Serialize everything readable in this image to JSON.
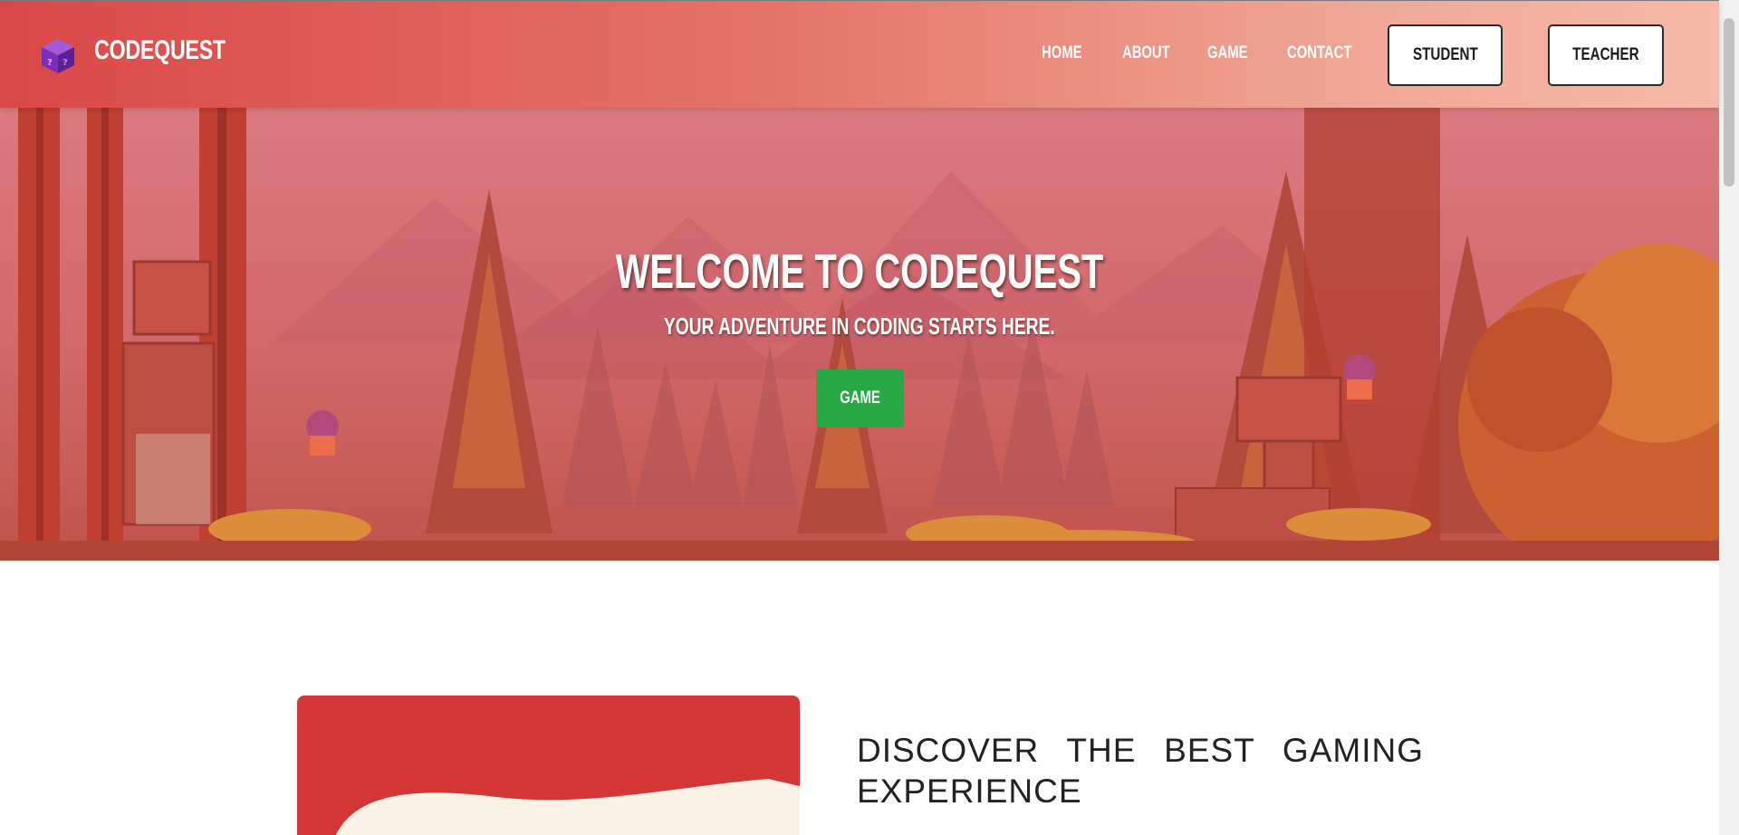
{
  "header": {
    "brand": "CODEQUEST",
    "logo_icon": "purple-cube-icon",
    "nav": [
      "HOME",
      "ABOUT",
      "GAME",
      "CONTACT"
    ],
    "buttons": {
      "student": "STUDENT",
      "teacher": "TEACHER"
    }
  },
  "hero": {
    "title": "WELCOME TO CODEQUEST",
    "subtitle": "YOUR ADVENTURE IN CODING STARTS HERE.",
    "cta": "GAME",
    "cta_color": "#28a745"
  },
  "section": {
    "heading": "DISCOVER THE BEST GAMING EXPERIENCE",
    "card_color": "#d43535"
  }
}
